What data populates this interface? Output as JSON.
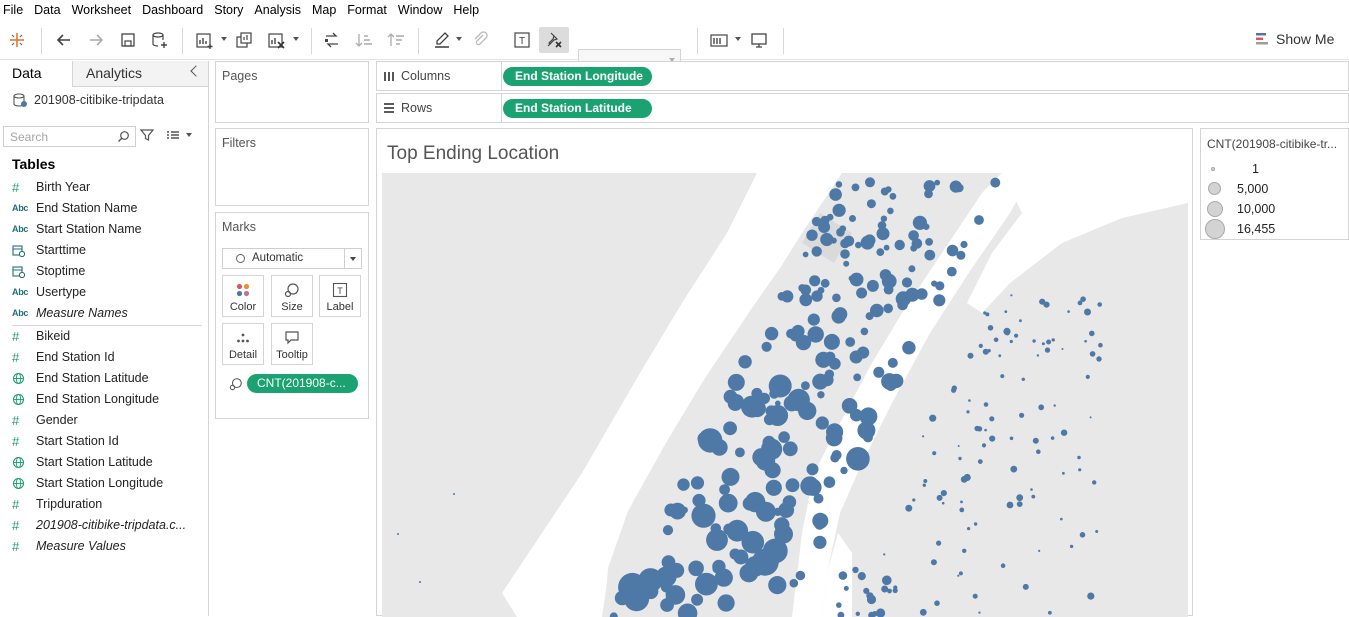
{
  "menu": [
    "File",
    "Data",
    "Worksheet",
    "Dashboard",
    "Story",
    "Analysis",
    "Map",
    "Format",
    "Window",
    "Help"
  ],
  "toolbar": {
    "show_me": "Show Me"
  },
  "data_pane": {
    "tabs": {
      "data": "Data",
      "analytics": "Analytics"
    },
    "source": "201908-citibike-tripdata",
    "search_placeholder": "Search",
    "tables_heading": "Tables",
    "dimensions": [
      {
        "label": "Birth Year",
        "icon": "hash"
      },
      {
        "label": "End Station Name",
        "icon": "abc"
      },
      {
        "label": "Start Station Name",
        "icon": "abc"
      },
      {
        "label": "Starttime",
        "icon": "date"
      },
      {
        "label": "Stoptime",
        "icon": "date"
      },
      {
        "label": "Usertype",
        "icon": "abc"
      },
      {
        "label": "Measure Names",
        "icon": "abc"
      }
    ],
    "measures": [
      {
        "label": "Bikeid",
        "icon": "hash"
      },
      {
        "label": "End Station Id",
        "icon": "hash"
      },
      {
        "label": "End Station Latitude",
        "icon": "globe"
      },
      {
        "label": "End Station Longitude",
        "icon": "globe"
      },
      {
        "label": "Gender",
        "icon": "hash"
      },
      {
        "label": "Start Station Id",
        "icon": "hash"
      },
      {
        "label": "Start Station Latitude",
        "icon": "globe"
      },
      {
        "label": "Start Station Longitude",
        "icon": "globe"
      },
      {
        "label": "Tripduration",
        "icon": "hash"
      },
      {
        "label": "201908-citibike-tripdata.c...",
        "icon": "hash"
      },
      {
        "label": "Measure Values",
        "icon": "hash"
      }
    ]
  },
  "cards": {
    "pages": "Pages",
    "filters": "Filters",
    "marks": "Marks",
    "mark_type": "Automatic",
    "buttons": {
      "color": "Color",
      "size": "Size",
      "label": "Label",
      "detail": "Detail",
      "tooltip": "Tooltip"
    },
    "size_pill": "CNT(201908-c..."
  },
  "shelves": {
    "columns_label": "Columns",
    "columns_pill": "End Station Longitude",
    "rows_label": "Rows",
    "rows_pill": "End Station Latitude"
  },
  "view": {
    "title": "Top Ending Location"
  },
  "legend": {
    "title": "CNT(201908-citibike-tr...",
    "entries": [
      {
        "label": "1",
        "value": 1
      },
      {
        "label": "5,000",
        "value": 5000
      },
      {
        "label": "10,000",
        "value": 10000
      },
      {
        "label": "16,455",
        "value": 16455
      }
    ]
  },
  "colors": {
    "pill": "#1aa371",
    "mark": "#4e79a7",
    "land": "#e8e8e8",
    "water": "#ffffff",
    "park": "#dadada"
  }
}
